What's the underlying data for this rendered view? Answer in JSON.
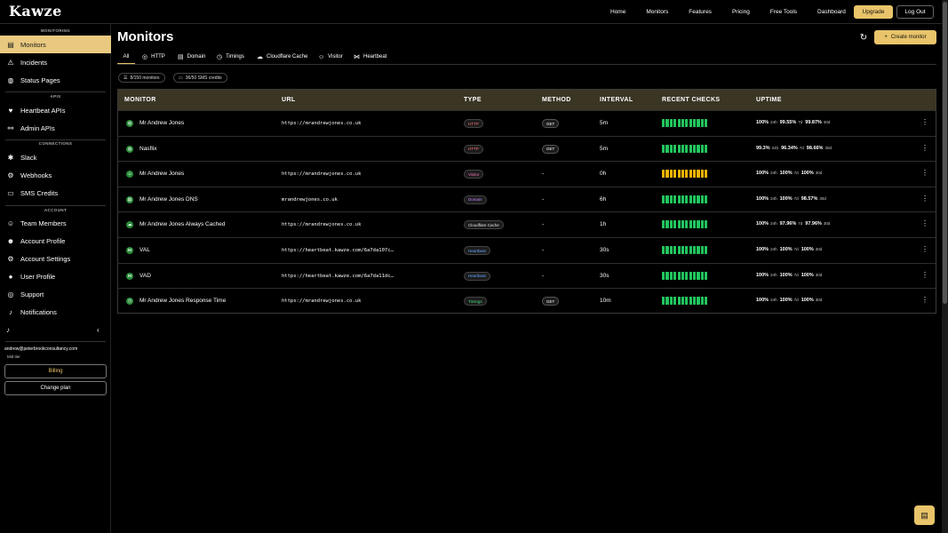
{
  "brand": "Kawze",
  "nav": [
    "Home",
    "Monitors",
    "Features",
    "Pricing",
    "Free Tools",
    "Dashboard"
  ],
  "header_buttons": {
    "upgrade": "Upgrade",
    "logout": "Log Out"
  },
  "sidebar": {
    "sections": {
      "monitoring": "MONITORING",
      "apis": "APIS",
      "connections": "CONNECTIONS",
      "account": "ACCOUNT"
    },
    "items": [
      {
        "label": "Monitors",
        "icon": "monitor-icon",
        "glyph": "▤"
      },
      {
        "label": "Incidents",
        "icon": "warning-icon",
        "glyph": "⚠"
      },
      {
        "label": "Status Pages",
        "icon": "globe-icon",
        "glyph": "◍"
      },
      {
        "label": "Heartbeat APIs",
        "icon": "heart-icon",
        "glyph": "♥"
      },
      {
        "label": "Admin APIs",
        "icon": "link-icon",
        "glyph": "⚯"
      },
      {
        "label": "Slack",
        "icon": "slack-icon",
        "glyph": "✱"
      },
      {
        "label": "Webhooks",
        "icon": "webhook-icon",
        "glyph": "⚙"
      },
      {
        "label": "SMS Credits",
        "icon": "message-icon",
        "glyph": "▭"
      },
      {
        "label": "Team Members",
        "icon": "team-icon",
        "glyph": "☺"
      },
      {
        "label": "Account Profile",
        "icon": "profile-icon",
        "glyph": "☻"
      },
      {
        "label": "Account Settings",
        "icon": "gear-icon",
        "glyph": "⚙"
      },
      {
        "label": "User Profile",
        "icon": "user-icon",
        "glyph": "●"
      },
      {
        "label": "Support",
        "icon": "support-icon",
        "glyph": "◎"
      },
      {
        "label": "Notifications",
        "icon": "bell-icon",
        "glyph": "♪"
      }
    ],
    "email": "andrew@peterbrookconsultancy.com",
    "tier": "Mid tier",
    "billing": "Billing",
    "change_plan": "Change plan"
  },
  "page": {
    "title": "Monitors",
    "create_button": "Create monitor",
    "tabs": [
      {
        "label": "All",
        "icon": ""
      },
      {
        "label": "HTTP",
        "icon": "◎"
      },
      {
        "label": "Domain",
        "icon": "▤"
      },
      {
        "label": "Timings",
        "icon": "◷"
      },
      {
        "label": "Cloudflare Cache",
        "icon": "☁"
      },
      {
        "label": "Visitor",
        "icon": "☺"
      },
      {
        "label": "Heartbeat",
        "icon": "⋈"
      }
    ],
    "pills": {
      "monitors": "8/150 monitors",
      "sms": "36/50 SMS credits"
    }
  },
  "table": {
    "headers": [
      "MONITOR",
      "URL",
      "TYPE",
      "METHOD",
      "INTERVAL",
      "RECENT CHECKS",
      "UPTIME"
    ],
    "rows": [
      {
        "name": "Mr Andrew Jones",
        "url": "https://mrandrewjones.co.uk",
        "type": "HTTP",
        "type_color": "#f87171",
        "method": "GET",
        "interval": "5m",
        "yellow": [],
        "u24": "100%",
        "u7": "99.55%",
        "u30": "99.87%",
        "icon": "◍"
      },
      {
        "name": "Nasflix",
        "url": "",
        "type": "HTTP",
        "type_color": "#f87171",
        "method": "GET",
        "interval": "5m",
        "yellow": [],
        "u24": "99.3%",
        "u7": "96.34%",
        "u30": "98.66%",
        "icon": "◍"
      },
      {
        "name": "Mr Andrew Jones",
        "url": "https://mrandrewjones.co.uk",
        "type": "Visitor",
        "type_color": "#f472b6",
        "method": "-",
        "interval": "0h",
        "yellow": [
          0,
          1,
          2,
          3,
          4,
          5,
          6,
          7,
          8,
          9,
          10,
          11
        ],
        "u24": "100%",
        "u7": "100%",
        "u30": "100%",
        "icon": "☺"
      },
      {
        "name": "Mr Andrew Jones DNS",
        "url": "mrandrewjones.co.uk",
        "type": "Domain",
        "type_color": "#c084fc",
        "method": "-",
        "interval": "6h",
        "yellow": [],
        "u24": "100%",
        "u7": "100%",
        "u30": "98.57%",
        "icon": "▤"
      },
      {
        "name": "Mr Andrew Jones Always Cached",
        "url": "https://mrandrewjones.co.uk",
        "type": "Cloudflare Cache",
        "type_color": "#e5e5e5",
        "method": "-",
        "interval": "1h",
        "yellow": [],
        "u24": "100%",
        "u7": "97.96%",
        "u30": "97.96%",
        "icon": "☁"
      },
      {
        "name": "VAL",
        "url": "https://heartbeat.kawze.com/6a7da107c…",
        "type": "Heartbeat",
        "type_color": "#60a5fa",
        "method": "-",
        "interval": "30s",
        "yellow": [],
        "u24": "100%",
        "u7": "100%",
        "u30": "100%",
        "icon": "⋈"
      },
      {
        "name": "VAD",
        "url": "https://heartbeat.kawze.com/6a7da11dc…",
        "type": "Heartbeat",
        "type_color": "#60a5fa",
        "method": "-",
        "interval": "30s",
        "yellow": [],
        "u24": "100%",
        "u7": "100%",
        "u30": "100%",
        "icon": "⋈"
      },
      {
        "name": "Mr Andrew Jones Response Time",
        "url": "https://mrandrewjones.co.uk",
        "type": "Timings",
        "type_color": "#4ade80",
        "method": "GET",
        "interval": "10m",
        "yellow": [],
        "u24": "100%",
        "u7": "100%",
        "u30": "100%",
        "icon": "◷"
      }
    ],
    "uptime_labels": {
      "d1": "24h",
      "d7": "7d",
      "d30": "30d"
    }
  }
}
